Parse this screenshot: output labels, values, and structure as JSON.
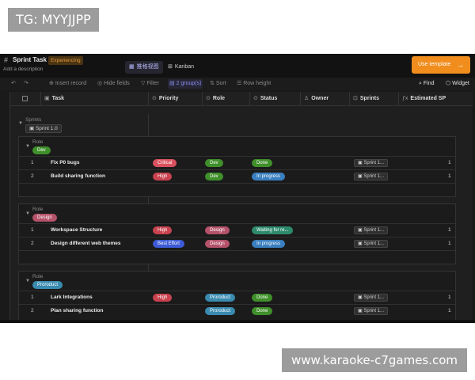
{
  "watermarks": {
    "top": "TG: MYYJJPP",
    "bottom": "www.karaoke-c7games.com"
  },
  "app": {
    "title": "Sprint Task",
    "badge": "Experiencing",
    "description": "Add a description",
    "views": [
      {
        "label": "推格视图",
        "icon": "grid-view-icon"
      },
      {
        "label": "Kanban",
        "icon": "kanban-icon"
      }
    ],
    "use_template": "Use template"
  },
  "toolbar": {
    "insert_record": "Insert record",
    "hide_fields": "Hide fields",
    "filter": "Filter",
    "group": "2 group(s)",
    "sort": "Sort",
    "row_height": "Row height",
    "find": "Find",
    "widget": "Widget"
  },
  "columns": [
    "Task",
    "Priority",
    "Role",
    "Status",
    "Owner",
    "Sprints",
    "Estimated SP"
  ],
  "outer_group": {
    "label": "Sprints",
    "value": "Sprint 1.0"
  },
  "groups": [
    {
      "label": "Role",
      "value": "Dev",
      "rows": [
        {
          "num": "1",
          "task": "Fix P0 bugs",
          "priority": "Critical",
          "role": "Dev",
          "status": "Done",
          "sprint": "Sprint 1...",
          "sp": "1"
        },
        {
          "num": "2",
          "task": "Build sharing function",
          "priority": "High",
          "role": "Dev",
          "status": "In progress",
          "sprint": "Sprint 1...",
          "sp": "1"
        }
      ]
    },
    {
      "label": "Role",
      "value": "Design",
      "rows": [
        {
          "num": "1",
          "task": "Workspace Structure",
          "priority": "High",
          "role": "Design",
          "status": "Waiting for re...",
          "sprint": "Sprint 1...",
          "sp": "1"
        },
        {
          "num": "2",
          "task": "Design different web themes",
          "priority": "Best Effort",
          "role": "Design",
          "status": "In progress",
          "sprint": "Sprint 1...",
          "sp": "1"
        }
      ]
    },
    {
      "label": "Role",
      "value": "Proroduct",
      "rows": [
        {
          "num": "1",
          "task": "Lark Integrations",
          "priority": "High",
          "role": "Proroduct",
          "status": "Done",
          "sprint": "Sprint 1...",
          "sp": "1"
        },
        {
          "num": "2",
          "task": "Plan sharing function",
          "priority": "",
          "role": "Proroduct",
          "status": "Done",
          "sprint": "Sprint 1...",
          "sp": "1"
        }
      ]
    }
  ],
  "colors": {
    "accent": "#f08d1d",
    "priority_critical": "#d9515e",
    "priority_high": "#c9424f",
    "priority_best_effort": "#3d5bd6",
    "role_dev": "#3f8f2a",
    "role_design": "#b4526a",
    "role_product": "#3a8bb0",
    "status_done": "#3f8f2a",
    "status_in_progress": "#3a7fbf",
    "status_waiting": "#2e8a6d"
  }
}
